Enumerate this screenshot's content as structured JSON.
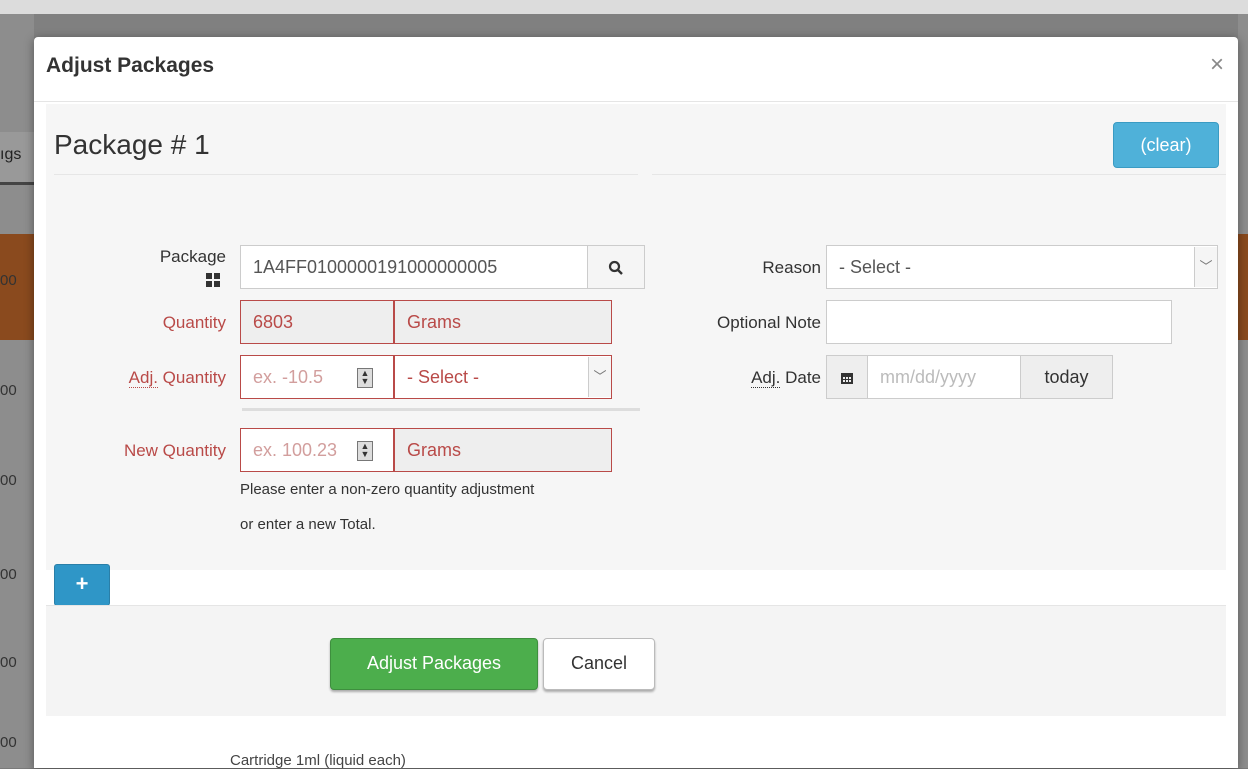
{
  "background": {
    "tab_fragment": "ıgs",
    "row_fragments": [
      "00",
      "00",
      "00",
      "00",
      "00",
      "00",
      "00"
    ],
    "bottom_fragment": "Cartridge 1ml    (liquid each)"
  },
  "modal": {
    "title": "Adjust Packages",
    "close_symbol": "×"
  },
  "package": {
    "title": "Package # 1",
    "clear_label": "(clear)",
    "package_label": "Package",
    "package_value": "1A4FF0100000191000000005",
    "quantity_label": "Quantity",
    "quantity_value": "6803",
    "quantity_unit": "Grams",
    "adj_quantity_label_abbr": "Adj.",
    "adj_quantity_label_rest": " Quantity",
    "adj_quantity_placeholder": "ex. -10.5",
    "adj_unit_select": "- Select -",
    "new_quantity_label": "New Quantity",
    "new_quantity_placeholder": "ex. 100.23",
    "new_quantity_unit": "Grams",
    "help_line1": "Please enter a non-zero quantity adjustment",
    "help_line2": "or enter a new Total.",
    "reason_label": "Reason",
    "reason_select": "- Select -",
    "optional_note_label": "Optional Note",
    "optional_note_value": "",
    "adj_date_label_abbr": "Adj.",
    "adj_date_label_rest": " Date",
    "adj_date_placeholder": "mm/dd/yyyy",
    "today_label": "today"
  },
  "actions": {
    "add_label": "+",
    "submit_label": "Adjust Packages",
    "cancel_label": "Cancel"
  },
  "colors": {
    "error": "#b94a48",
    "primary": "#4cae4c",
    "info": "#4fb1d9"
  }
}
